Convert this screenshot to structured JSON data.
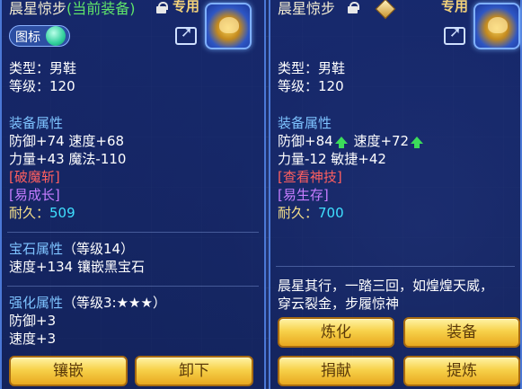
{
  "left_panel": {
    "title": "晨星惊步",
    "current_tag": "(当前装备)",
    "exclusive": "专用",
    "toggle_label": "图标",
    "type_line": "类型：男鞋",
    "level_line": "等级：120",
    "attr_header": "装备属性",
    "attr_line1": "防御+74 速度+68",
    "attr_line2": "力量+43 魔法-110",
    "skill1": "[破魔斩]",
    "skill2": "[易成长]",
    "durability_label": "耐久：",
    "durability_value": "509",
    "gem_header": "宝石属性",
    "gem_level": "（等级14）",
    "gem_line": "速度+134 镶嵌黑宝石",
    "enhance_header": "强化属性",
    "enhance_level": "（等级3:★★★）",
    "enhance_line1": "防御+3",
    "enhance_line2": "速度+3",
    "buttons": [
      "镶嵌",
      "卸下"
    ]
  },
  "right_panel": {
    "title": "晨星惊步",
    "exclusive": "专用",
    "type_line": "类型：男鞋",
    "level_line": "等级：120",
    "attr_header": "装备属性",
    "defense": "防御+84",
    "speed": "速度+72",
    "attr_line2": "力量-12 敏捷+42",
    "skill1": "[查看神技]",
    "skill2": "[易生存]",
    "durability_label": "耐久：",
    "durability_value": "700",
    "description_line1": "晨星其行，一踏三回，如煌煌天威，",
    "description_line2": "穿云裂金，步履惊神",
    "buttons": [
      "炼化",
      "装备",
      "捐献",
      "提炼"
    ]
  },
  "colors": {
    "accent_green": "#5fe36a",
    "attr_blue": "#7ec3ff",
    "skill_red": "#ff5f5f",
    "skill_purple": "#c77dff",
    "durability_cyan": "#3fe0ff",
    "button_gold": "#f7d14a"
  }
}
